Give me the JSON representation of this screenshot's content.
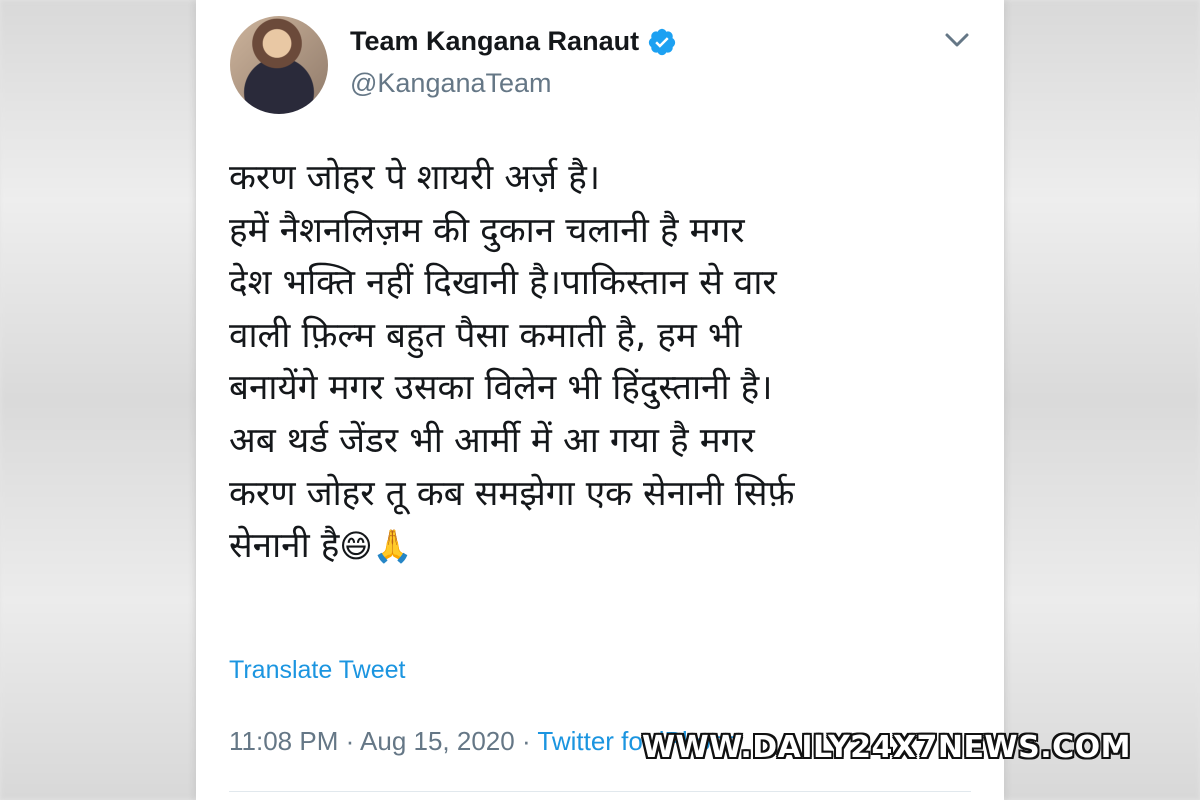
{
  "tweet": {
    "display_name": "Team Kangana Ranaut",
    "handle": "@KanganaTeam",
    "verified_icon": "verified-badge-icon",
    "menu_icon": "chevron-down-icon",
    "lines": [
      "करण जोहर पे शायरी अर्ज़ है।",
      "हमें नैशनलिज़म की दुकान चलानी है मगर",
      "देश भक्ति नहीं दिखानी है।पाकिस्तान से वार",
      "वाली फ़िल्म बहुत पैसा कमाती है, हम भी",
      "बनायेंगे मगर उसका विलेन भी हिंदुस्तानी है।",
      "अब थर्ड जेंडर भी आर्मी में आ गया है मगर",
      "करण जोहर तू कब समझेगा एक सेनानी सिर्फ़",
      "सेनानी है"
    ],
    "emojis": "😄🙏",
    "translate_label": "Translate Tweet",
    "time": "11:08 PM",
    "separator": " · ",
    "date": "Aug 15, 2020",
    "source": "Twitter for iPhone"
  },
  "watermark": "WWW.DAILY24X7NEWS.COM",
  "colors": {
    "link": "#1b95e0",
    "text": "#14171a",
    "muted": "#657786"
  }
}
